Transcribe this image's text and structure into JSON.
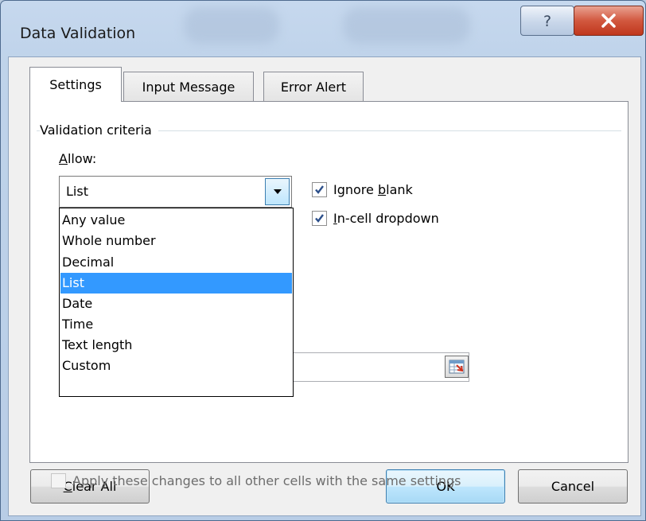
{
  "window": {
    "title": "Data Validation",
    "help_glyph": "?",
    "close_glyph": "X"
  },
  "tabs": [
    {
      "label": "Settings",
      "active": true
    },
    {
      "label": "Input Message",
      "active": false
    },
    {
      "label": "Error Alert",
      "active": false
    }
  ],
  "settings": {
    "section_label": "Validation criteria",
    "allow": {
      "label_accel": "A",
      "label_rest": "llow:",
      "value": "List",
      "options": [
        "Any value",
        "Whole number",
        "Decimal",
        "List",
        "Date",
        "Time",
        "Text length",
        "Custom"
      ],
      "selected_index": 3
    },
    "ignore_blank": {
      "pre": "Ignore ",
      "accel": "b",
      "post": "lank",
      "checked": true
    },
    "incell_dropdown": {
      "pre": "",
      "accel": "I",
      "post": "n-cell dropdown",
      "checked": true
    },
    "apply_all": {
      "label": "Apply these changes to all other cells with the same settings",
      "checked": false,
      "enabled": false
    }
  },
  "buttons": {
    "clear_all_accel": "C",
    "clear_all_rest": "lear All",
    "ok": "OK",
    "cancel": "Cancel"
  },
  "icons": {
    "help": "help-icon",
    "close": "close-icon",
    "dropdown_arrow": "chevron-down-icon",
    "range_picker": "collapse-dialog-icon",
    "checkmark": "checkmark-icon"
  }
}
